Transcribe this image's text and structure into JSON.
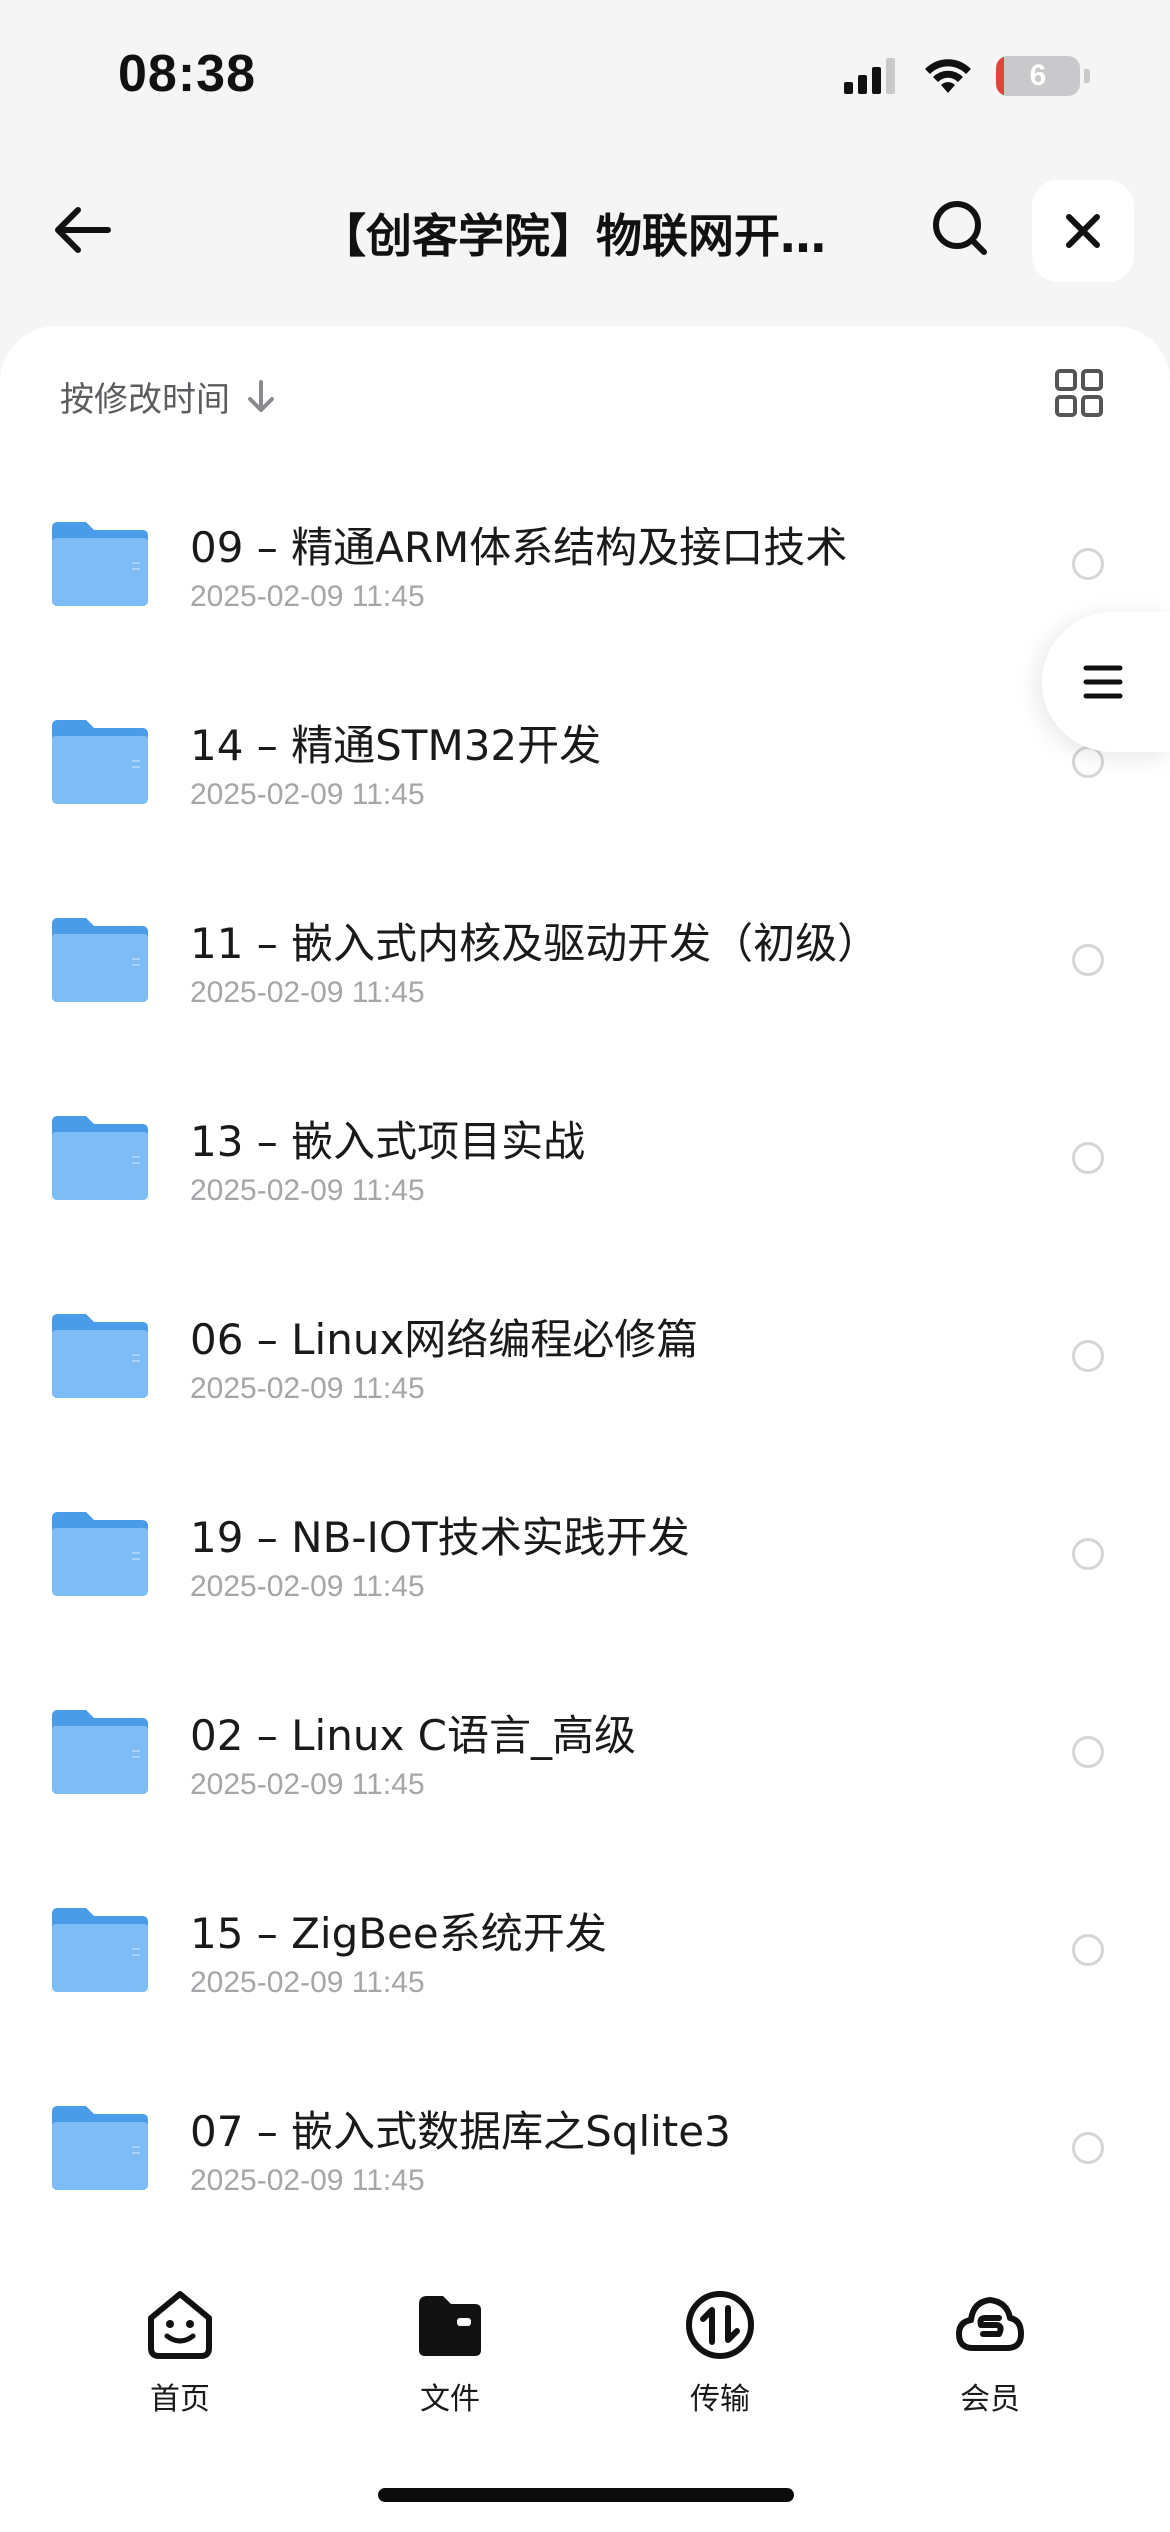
{
  "status_bar": {
    "time": "08:38",
    "battery_level": "6",
    "battery_fraction": 0.06,
    "signal_icon": "cellular-signal-icon",
    "wifi_icon": "wifi-icon"
  },
  "header": {
    "title": "【创客学院】物联网开…",
    "back_icon": "arrow-left-icon",
    "search_icon": "search-icon",
    "close_icon": "close-icon"
  },
  "sort_bar": {
    "label": "按修改时间",
    "arrow_icon": "arrow-down-icon",
    "view_toggle_icon": "grid-view-icon"
  },
  "floating_menu": {
    "icon": "menu-icon"
  },
  "files": [
    {
      "name": "09 – 精通ARM体系结构及接口技术",
      "date": "2025-02-09 11:45"
    },
    {
      "name": "14 – 精通STM32开发",
      "date": "2025-02-09 11:45"
    },
    {
      "name": "11 – 嵌入式内核及驱动开发（初级）",
      "date": "2025-02-09 11:45"
    },
    {
      "name": "13 – 嵌入式项目实战",
      "date": "2025-02-09 11:45"
    },
    {
      "name": "06 – Linux网络编程必修篇",
      "date": "2025-02-09 11:45"
    },
    {
      "name": "19 – NB-IOT技术实践开发",
      "date": "2025-02-09 11:45"
    },
    {
      "name": "02 – Linux C语言_高级",
      "date": "2025-02-09 11:45"
    },
    {
      "name": "15 – ZigBee系统开发",
      "date": "2025-02-09 11:45"
    },
    {
      "name": "07 – 嵌入式数据库之Sqlite3",
      "date": "2025-02-09 11:45"
    }
  ],
  "tab_bar": {
    "tabs": [
      {
        "label": "首页",
        "icon": "smiley-home-icon"
      },
      {
        "label": "文件",
        "icon": "folder-tab-icon",
        "active": true
      },
      {
        "label": "传输",
        "icon": "transfer-icon"
      },
      {
        "label": "会员",
        "icon": "cloud-vip-icon"
      }
    ]
  },
  "colors": {
    "background": "#f5f5f6",
    "card": "#ffffff",
    "folder_blue": "#6fb3f2",
    "text_primary": "#1a1a1a",
    "text_secondary": "#a6a6aa",
    "battery_low": "#e5433a"
  }
}
